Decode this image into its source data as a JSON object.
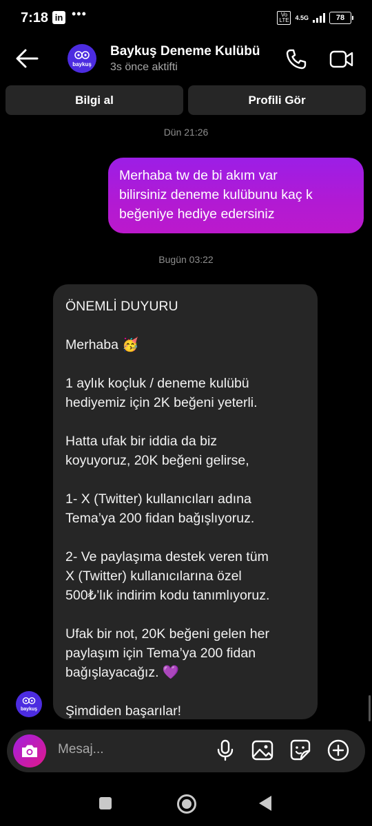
{
  "status_bar": {
    "time": "7:18",
    "app_icon": "in",
    "more": "•••",
    "volte": "Vo LTE",
    "network": "4.5G",
    "battery": "78"
  },
  "header": {
    "contact_name": "Baykuş Deneme Kulübü",
    "status": "3s önce aktifti",
    "avatar_label": "baykuş",
    "icons": [
      "back-arrow-icon",
      "phone-icon",
      "video-icon"
    ]
  },
  "actions": {
    "info_label": "Bilgi al",
    "profile_label": "Profili Gör"
  },
  "conversation": {
    "timestamp_1": "Dün 21:26",
    "outgoing_message": "Merhaba tw de bi akım var\nbilirsiniz  deneme kulübunu kaç k\nbeğeniye hediye edersiniz",
    "timestamp_2": "Bugün 03:22",
    "incoming_message": "ÖNEMLİ DUYURU\n\nMerhaba 🥳\n\n1 aylık koçluk / deneme kulübü\nhediyemiz için 2K beğeni yeterli.\n\nHatta ufak bir iddia da biz\nkoyuyoruz, 20K beğeni gelirse,\n\n1- X (Twitter) kullanıcıları adına\nTema’ya 200 fidan bağışlıyoruz.\n\n2- Ve paylaşıma destek veren tüm\nX (Twitter) kullanıcılarına özel\n500₺’lık indirim kodu tanımlıyoruz.\n\nUfak bir not, 20K beğeni gelen her\npaylaşım için Tema’ya 200 fidan\nbağışlayacağız. 💜\n\nŞimdiden başarılar!"
  },
  "composer": {
    "placeholder": "Mesaj...",
    "icons": [
      "camera-icon",
      "microphone-icon",
      "gallery-icon",
      "sticker-icon",
      "plus-icon"
    ],
    "camera_gradient": [
      "#a11fe0",
      "#e0198a"
    ]
  },
  "colors": {
    "outgoing_bubble": "#b21ad3",
    "incoming_bubble": "#262626",
    "avatar_bg": "#4c2ce0"
  }
}
